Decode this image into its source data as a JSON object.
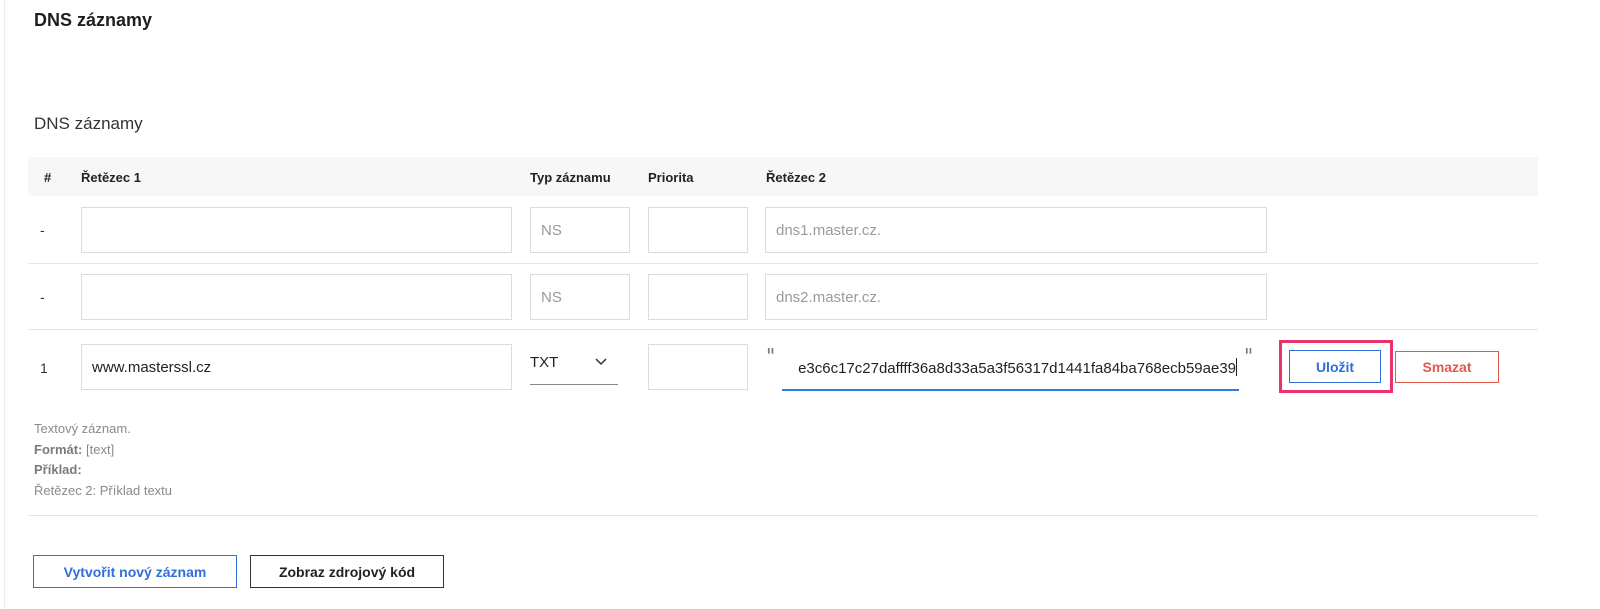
{
  "page": {
    "title": "DNS záznamy"
  },
  "section": {
    "title": "DNS záznamy"
  },
  "table": {
    "columns": [
      "#",
      "Řetězec 1",
      "Typ záznamu",
      "Priorita",
      "Řetězec 2"
    ],
    "rows": [
      {
        "num": "-",
        "string1": "",
        "type": "NS",
        "priority": "",
        "string2": "dns1.master.cz."
      },
      {
        "num": "-",
        "string1": "",
        "type": "NS",
        "priority": "",
        "string2": "dns2.master.cz."
      },
      {
        "num": "1",
        "string1": "www.masterssl.cz",
        "type": "TXT",
        "priority": "",
        "string2": "e3c6c17c27daffff36a8d33a5a3f56317d1441fa84ba768ecb59ae39"
      }
    ]
  },
  "quote_open": "\"",
  "quote_close": "\"",
  "actions": {
    "save": "Uložit",
    "delete": "Smazat"
  },
  "help": {
    "description": "Textový záznam.",
    "format_label": "Formát:",
    "format_value": "[text]",
    "example_label": "Příklad:",
    "example_value": "Řetězec 2: Příklad textu"
  },
  "footer": {
    "create": "Vytvořit nový záznam",
    "source": "Zobraz zdrojový kód"
  },
  "colors": {
    "accent": "#2f6fd6",
    "danger": "#e05a4d",
    "highlight": "#e8336d"
  },
  "icons": {
    "type_select": "chevron-down-icon"
  }
}
